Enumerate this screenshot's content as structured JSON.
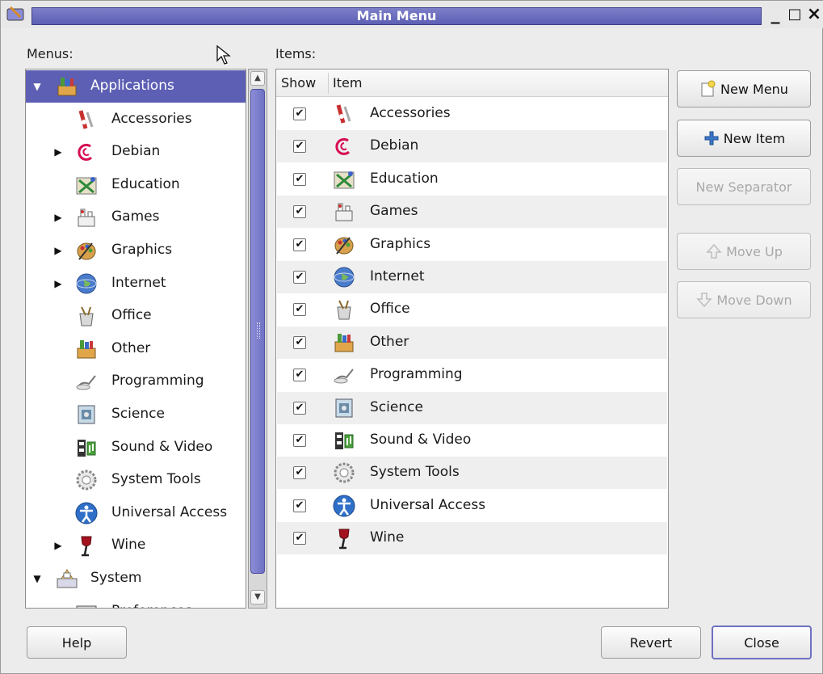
{
  "window": {
    "title": "Main Menu",
    "controls": [
      "minimize",
      "maximize",
      "close"
    ],
    "control_glyphs": {
      "minimize": "_",
      "maximize": "□",
      "close": "×"
    }
  },
  "menus_label": "Menus:",
  "items_label": "Items:",
  "menu_tree": [
    {
      "label": "Applications",
      "icon": "applications-icon",
      "expander": "expanded",
      "level": 0,
      "selected": true
    },
    {
      "label": "Accessories",
      "icon": "accessories-icon",
      "expander": "none",
      "level": 1
    },
    {
      "label": "Debian",
      "icon": "debian-icon",
      "expander": "collapsed",
      "level": 1
    },
    {
      "label": "Education",
      "icon": "education-icon",
      "expander": "none",
      "level": 1
    },
    {
      "label": "Games",
      "icon": "games-icon",
      "expander": "collapsed",
      "level": 1
    },
    {
      "label": "Graphics",
      "icon": "graphics-icon",
      "expander": "collapsed",
      "level": 1
    },
    {
      "label": "Internet",
      "icon": "internet-icon",
      "expander": "collapsed",
      "level": 1
    },
    {
      "label": "Office",
      "icon": "office-icon",
      "expander": "none",
      "level": 1
    },
    {
      "label": "Other",
      "icon": "other-icon",
      "expander": "none",
      "level": 1
    },
    {
      "label": "Programming",
      "icon": "programming-icon",
      "expander": "none",
      "level": 1
    },
    {
      "label": "Science",
      "icon": "science-icon",
      "expander": "none",
      "level": 1
    },
    {
      "label": "Sound & Video",
      "icon": "sound-video-icon",
      "expander": "none",
      "level": 1
    },
    {
      "label": "System Tools",
      "icon": "system-tools-icon",
      "expander": "none",
      "level": 1
    },
    {
      "label": "Universal Access",
      "icon": "universal-access-icon",
      "expander": "none",
      "level": 1
    },
    {
      "label": "Wine",
      "icon": "wine-icon",
      "expander": "collapsed",
      "level": 1
    },
    {
      "label": "System",
      "icon": "system-icon",
      "expander": "expanded",
      "level": 0
    },
    {
      "label": "Preferences",
      "icon": "preferences-icon",
      "expander": "none",
      "level": 1
    }
  ],
  "items_table": {
    "columns": [
      "Show",
      "Item"
    ],
    "rows": [
      {
        "show": true,
        "label": "Accessories",
        "icon": "accessories-icon"
      },
      {
        "show": true,
        "label": "Debian",
        "icon": "debian-icon"
      },
      {
        "show": true,
        "label": "Education",
        "icon": "education-icon"
      },
      {
        "show": true,
        "label": "Games",
        "icon": "games-icon"
      },
      {
        "show": true,
        "label": "Graphics",
        "icon": "graphics-icon"
      },
      {
        "show": true,
        "label": "Internet",
        "icon": "internet-icon"
      },
      {
        "show": true,
        "label": "Office",
        "icon": "office-icon"
      },
      {
        "show": true,
        "label": "Other",
        "icon": "other-icon"
      },
      {
        "show": true,
        "label": "Programming",
        "icon": "programming-icon"
      },
      {
        "show": true,
        "label": "Science",
        "icon": "science-icon"
      },
      {
        "show": true,
        "label": "Sound & Video",
        "icon": "sound-video-icon"
      },
      {
        "show": true,
        "label": "System Tools",
        "icon": "system-tools-icon"
      },
      {
        "show": true,
        "label": "Universal Access",
        "icon": "universal-access-icon"
      },
      {
        "show": true,
        "label": "Wine",
        "icon": "wine-icon"
      }
    ]
  },
  "buttons": {
    "new_menu": "New Menu",
    "new_item": "New Item",
    "new_separator": "New Separator",
    "move_up": "Move Up",
    "move_down": "Move Down",
    "help": "Help",
    "revert": "Revert",
    "close": "Close"
  },
  "colors": {
    "selection": "#5d5fb4",
    "title_bar": "#6d6fbd",
    "scroll_thumb": "#7a7ccc"
  }
}
